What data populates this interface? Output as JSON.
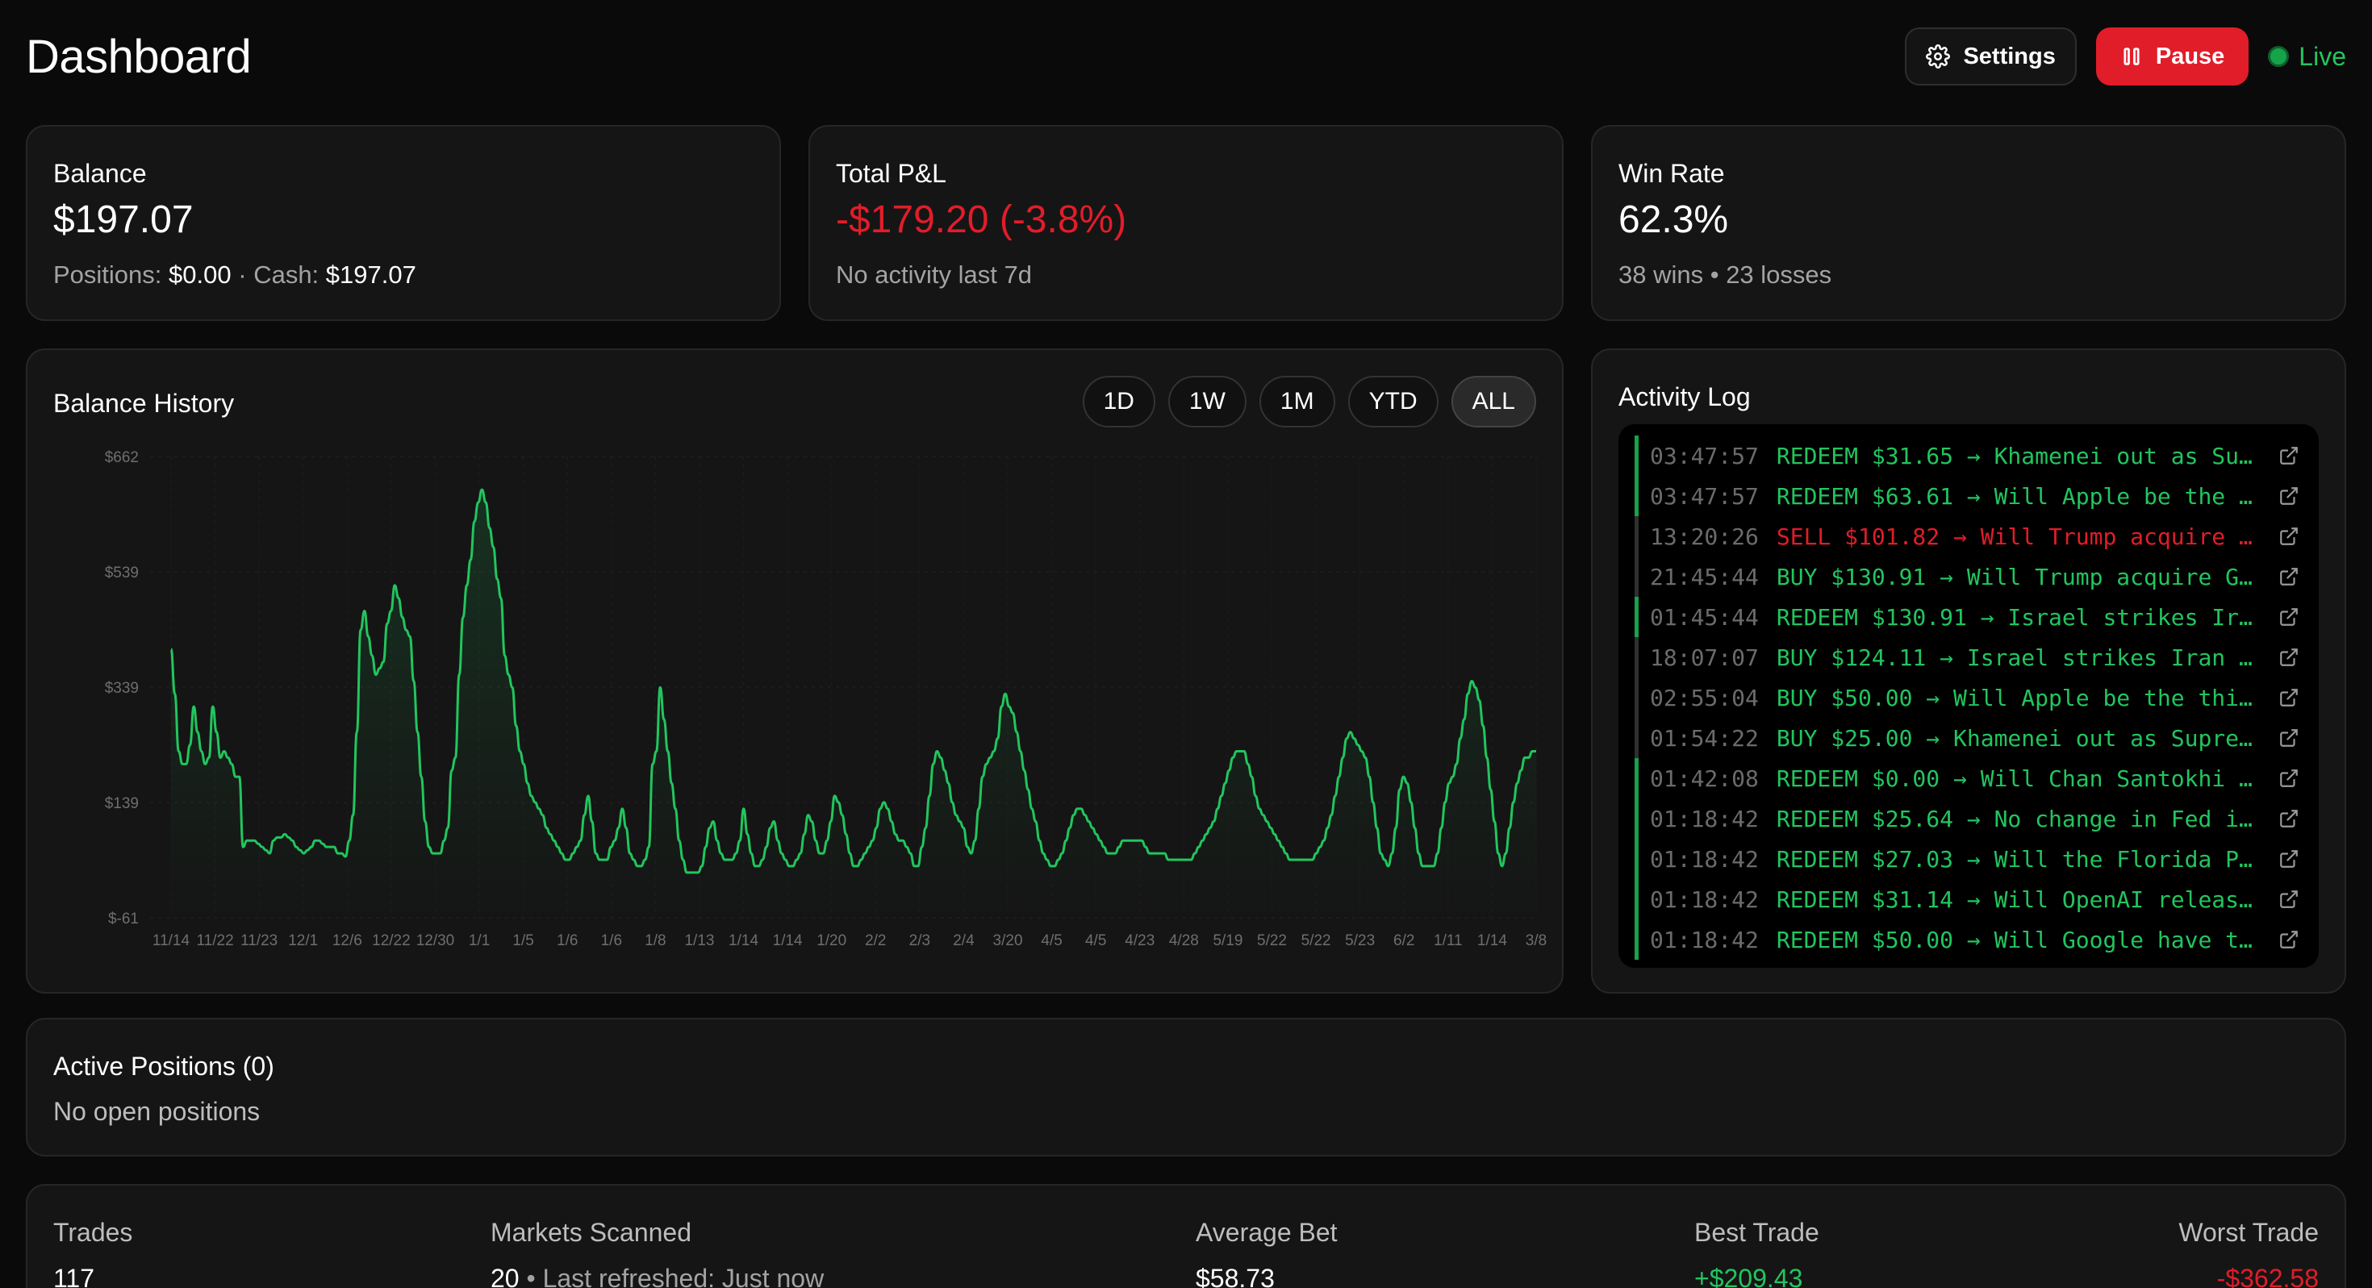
{
  "header": {
    "title": "Dashboard",
    "settings_label": "Settings",
    "pause_label": "Pause",
    "status_label": "Live"
  },
  "stats": {
    "balance": {
      "label": "Balance",
      "value": "$197.07",
      "positions_label": "Positions:",
      "positions_value": "$0.00",
      "separator": "·",
      "cash_label": "Cash:",
      "cash_value": "$197.07"
    },
    "pnl": {
      "label": "Total P&L",
      "value": "-$179.20 (-3.8%)",
      "sub": "No activity last 7d"
    },
    "winrate": {
      "label": "Win Rate",
      "value": "62.3%",
      "sub": "38 wins • 23 losses"
    }
  },
  "balance_history": {
    "title": "Balance History",
    "ranges": [
      "1D",
      "1W",
      "1M",
      "YTD",
      "ALL"
    ],
    "active_range": "ALL"
  },
  "chart_data": {
    "type": "area",
    "ylim": [
      -61,
      662
    ],
    "yticks": [
      "$662",
      "$539",
      "$339",
      "$139",
      "$-61"
    ],
    "xticks": [
      "11/14",
      "11/22",
      "11/23",
      "12/1",
      "12/6",
      "12/22",
      "12/30",
      "1/1",
      "1/5",
      "1/6",
      "1/6",
      "1/8",
      "1/13",
      "1/14",
      "1/14",
      "1/20",
      "2/2",
      "2/3",
      "2/4",
      "3/20",
      "4/5",
      "4/5",
      "4/23",
      "4/28",
      "5/19",
      "5/22",
      "5/22",
      "5/23",
      "6/2",
      "1/11",
      "1/14",
      "3/8"
    ],
    "grid": true,
    "color": "#22c55e",
    "values": [
      360,
      290,
      200,
      180,
      180,
      210,
      270,
      230,
      200,
      180,
      190,
      270,
      230,
      190,
      200,
      190,
      180,
      160,
      160,
      50,
      60,
      60,
      60,
      55,
      50,
      45,
      40,
      60,
      65,
      65,
      70,
      65,
      60,
      50,
      45,
      40,
      45,
      50,
      60,
      60,
      55,
      50,
      50,
      50,
      40,
      40,
      35,
      60,
      100,
      230,
      390,
      420,
      380,
      350,
      320,
      330,
      340,
      400,
      420,
      460,
      440,
      410,
      390,
      380,
      310,
      230,
      160,
      90,
      50,
      40,
      40,
      40,
      60,
      80,
      170,
      190,
      320,
      410,
      460,
      500,
      560,
      590,
      610,
      590,
      550,
      520,
      470,
      440,
      350,
      320,
      300,
      240,
      200,
      180,
      150,
      130,
      120,
      110,
      100,
      80,
      70,
      60,
      50,
      40,
      30,
      30,
      40,
      50,
      60,
      100,
      130,
      90,
      40,
      30,
      30,
      30,
      50,
      60,
      80,
      110,
      80,
      40,
      30,
      20,
      20,
      30,
      50,
      180,
      200,
      300,
      250,
      200,
      150,
      110,
      60,
      30,
      10,
      10,
      10,
      10,
      20,
      50,
      80,
      90,
      60,
      40,
      30,
      30,
      30,
      40,
      60,
      110,
      70,
      40,
      20,
      20,
      30,
      50,
      80,
      90,
      60,
      40,
      30,
      20,
      20,
      30,
      40,
      70,
      100,
      90,
      60,
      40,
      40,
      60,
      90,
      130,
      120,
      100,
      70,
      40,
      20,
      20,
      30,
      40,
      50,
      60,
      80,
      110,
      120,
      110,
      90,
      70,
      60,
      60,
      50,
      40,
      20,
      20,
      50,
      80,
      130,
      180,
      200,
      190,
      170,
      150,
      120,
      100,
      90,
      80,
      50,
      40,
      60,
      110,
      160,
      180,
      190,
      200,
      220,
      270,
      290,
      270,
      260,
      230,
      200,
      170,
      140,
      110,
      90,
      60,
      40,
      30,
      20,
      20,
      30,
      40,
      60,
      80,
      100,
      110,
      110,
      100,
      90,
      80,
      70,
      60,
      50,
      40,
      40,
      40,
      50,
      60,
      60,
      60,
      60,
      60,
      60,
      50,
      40,
      40,
      40,
      40,
      40,
      30,
      30,
      30,
      30,
      30,
      30,
      30,
      40,
      50,
      60,
      70,
      80,
      90,
      110,
      130,
      150,
      170,
      190,
      200,
      200,
      200,
      180,
      160,
      130,
      110,
      100,
      90,
      80,
      70,
      60,
      50,
      40,
      30,
      30,
      30,
      30,
      30,
      30,
      30,
      40,
      50,
      60,
      80,
      100,
      130,
      160,
      190,
      220,
      230,
      220,
      210,
      200,
      190,
      160,
      120,
      80,
      40,
      30,
      20,
      40,
      80,
      140,
      160,
      150,
      120,
      80,
      40,
      20,
      20,
      20,
      20,
      40,
      80,
      120,
      150,
      160,
      180,
      220,
      250,
      290,
      310,
      300,
      280,
      240,
      190,
      140,
      90,
      40,
      20,
      40,
      80,
      120,
      150,
      170,
      190,
      190,
      200,
      200
    ]
  },
  "activity_log": {
    "title": "Activity Log",
    "entries": [
      {
        "time": "03:47:57",
        "type": "redeem",
        "text": "REDEEM $31.65 → Khamenei out as Su…"
      },
      {
        "time": "03:47:57",
        "type": "redeem",
        "text": "REDEEM $63.61 → Will Apple be the …"
      },
      {
        "time": "13:20:26",
        "type": "sell",
        "text": "SELL $101.82 → Will Trump acquire …"
      },
      {
        "time": "21:45:44",
        "type": "buy",
        "text": "BUY $130.91 → Will Trump acquire G…"
      },
      {
        "time": "01:45:44",
        "type": "redeem",
        "text": "REDEEM $130.91 → Israel strikes Ir…"
      },
      {
        "time": "18:07:07",
        "type": "buy",
        "text": "BUY $124.11 → Israel strikes Iran …"
      },
      {
        "time": "02:55:04",
        "type": "buy",
        "text": "BUY $50.00 → Will Apple be the thi…"
      },
      {
        "time": "01:54:22",
        "type": "buy",
        "text": "BUY $25.00 → Khamenei out as Supre…"
      },
      {
        "time": "01:42:08",
        "type": "redeem",
        "text": "REDEEM $0.00 → Will Chan Santokhi …"
      },
      {
        "time": "01:18:42",
        "type": "redeem",
        "text": "REDEEM $25.64 → No change in Fed i…"
      },
      {
        "time": "01:18:42",
        "type": "redeem",
        "text": "REDEEM $27.03 → Will the Florida P…"
      },
      {
        "time": "01:18:42",
        "type": "redeem",
        "text": "REDEEM $31.14 → Will OpenAI releas…"
      },
      {
        "time": "01:18:42",
        "type": "redeem",
        "text": "REDEEM $50.00 → Will Google have t…"
      }
    ]
  },
  "positions": {
    "title": "Active Positions (0)",
    "empty": "No open positions"
  },
  "metrics": {
    "trades": {
      "label": "Trades",
      "value": "117"
    },
    "scanned": {
      "label": "Markets Scanned",
      "value": "20",
      "sub": "• Last refreshed: Just now"
    },
    "avg_bet": {
      "label": "Average Bet",
      "value": "$58.73"
    },
    "best": {
      "label": "Best Trade",
      "value": "+$209.43"
    },
    "worst": {
      "label": "Worst Trade",
      "value": "-$362.58"
    }
  }
}
